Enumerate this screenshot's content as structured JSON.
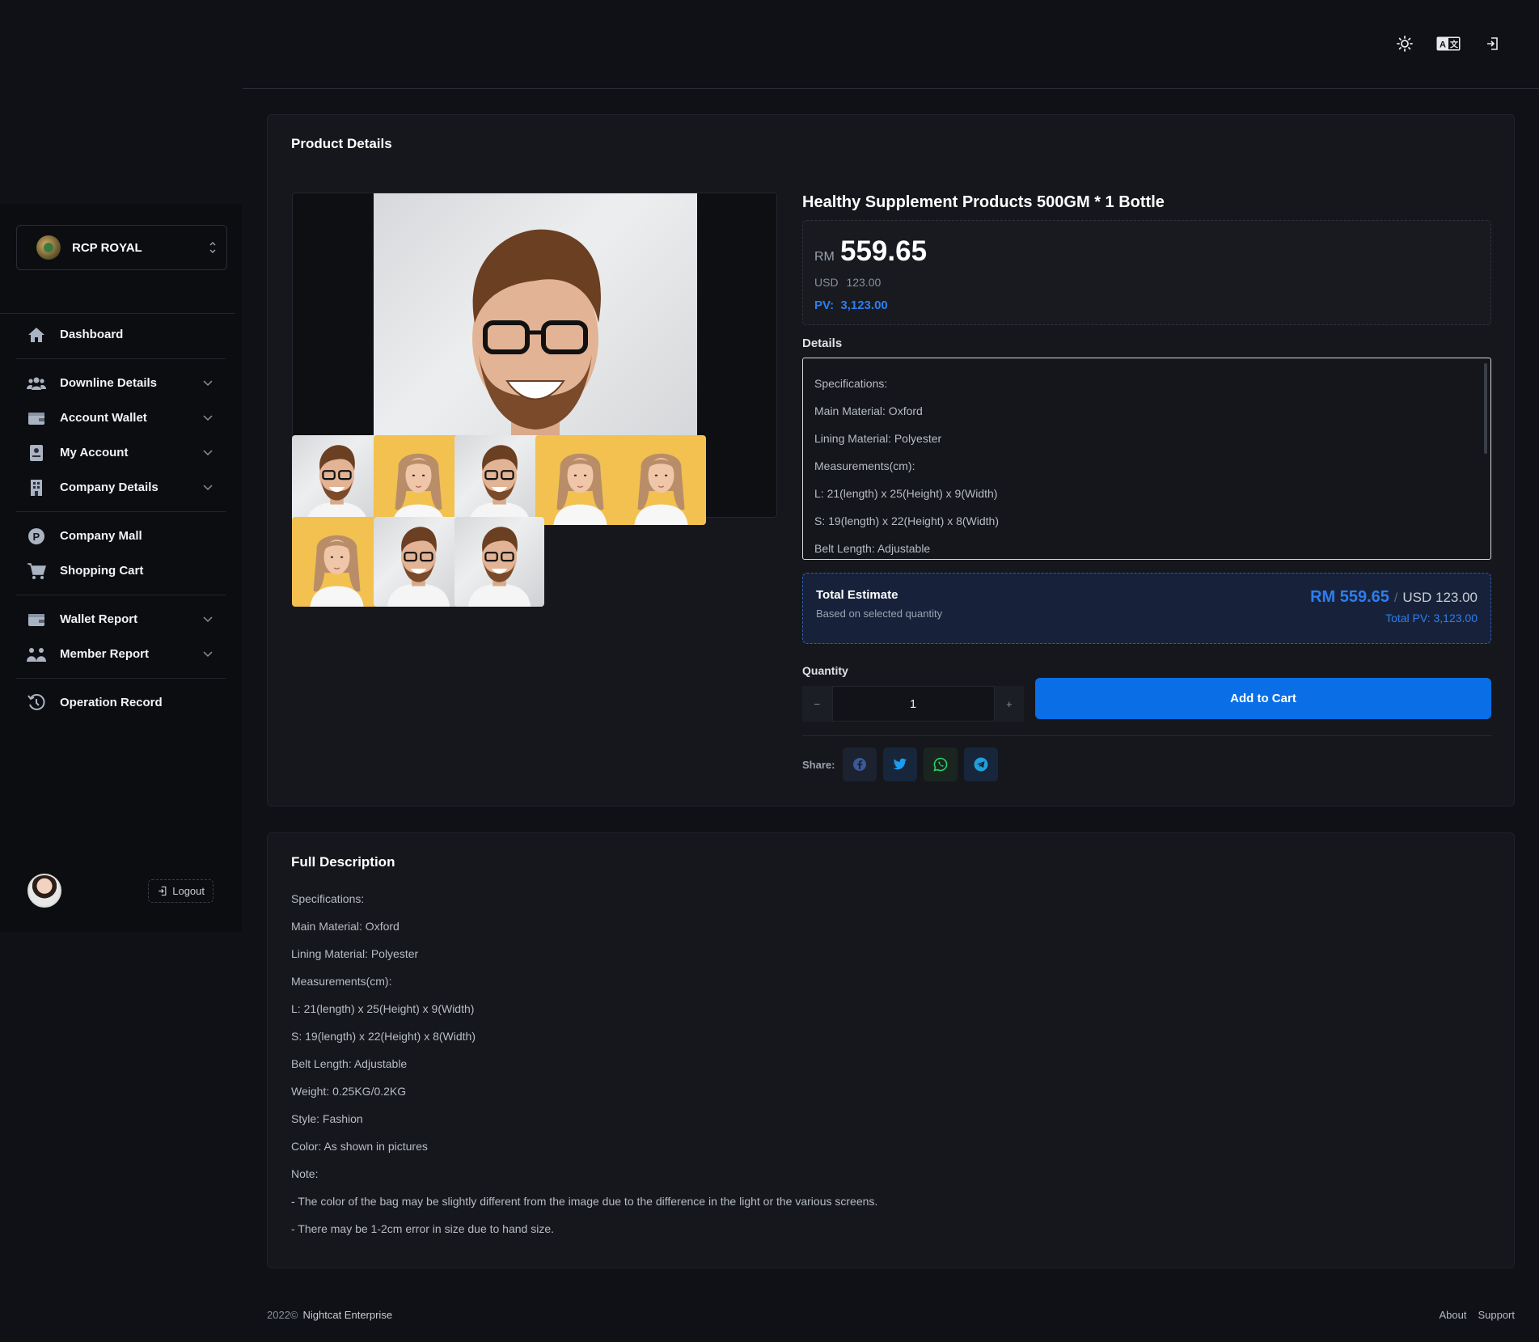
{
  "header": {
    "icons": [
      "sun-icon",
      "translate-icon",
      "login-icon"
    ]
  },
  "sidebar": {
    "brand": "RCP ROYAL",
    "groups": [
      [
        {
          "label": "Dashboard",
          "icon": "home-icon"
        }
      ],
      [
        {
          "label": "Downline Details",
          "icon": "users-icon"
        },
        {
          "label": "Account Wallet",
          "icon": "wallet-icon"
        },
        {
          "label": "My Account",
          "icon": "id-card-icon"
        },
        {
          "label": "Company Details",
          "icon": "building-icon"
        }
      ],
      [
        {
          "label": "Company Mall",
          "icon": "p-coin-icon"
        },
        {
          "label": "Shopping Cart",
          "icon": "cart-icon"
        }
      ],
      [
        {
          "label": "Wallet Report",
          "icon": "wallet-icon"
        },
        {
          "label": "Member Report",
          "icon": "people-icon"
        }
      ],
      [
        {
          "label": "Operation Record",
          "icon": "history-icon"
        }
      ]
    ],
    "logout_label": "Logout"
  },
  "product": {
    "card_title": "Product Details",
    "title": "Healthy Supplement Products 500GM * 1 Bottle",
    "price_currency": "RM",
    "price_value": "559.65",
    "usd_label": "USD",
    "usd_value": "123.00",
    "pv_label": "PV:",
    "pv_value": "3,123.00",
    "details_label": "Details",
    "details": [
      "Specifications:",
      "Main Material: Oxford",
      "Lining Material: Polyester",
      "Measurements(cm):",
      "L: 21(length) x 25(Height) x 9(Width)",
      "S: 19(length) x 22(Height) x 8(Width)",
      "Belt Length: Adjustable"
    ],
    "thumbnails": [
      "man",
      "woman",
      "man",
      "woman",
      "woman",
      "woman",
      "man",
      "man"
    ]
  },
  "estimate": {
    "title": "Total Estimate",
    "subtitle": "Based on selected quantity",
    "rm": "RM 559.65",
    "slash": "/",
    "usd": "USD 123.00",
    "pv": "Total PV: 3,123.00"
  },
  "quantity": {
    "label": "Quantity",
    "value": "1",
    "minus": "−",
    "plus": "+"
  },
  "cart": {
    "add_label": "Add to Cart"
  },
  "share": {
    "label": "Share:",
    "networks": [
      "facebook-icon",
      "twitter-icon",
      "whatsapp-icon",
      "telegram-icon"
    ]
  },
  "description": {
    "title": "Full Description",
    "lines": [
      "Specifications:",
      "Main Material: Oxford",
      "Lining Material: Polyester",
      "Measurements(cm):",
      "L: 21(length) x 25(Height) x 9(Width)",
      "S: 19(length) x 22(Height) x 8(Width)",
      "Belt Length: Adjustable",
      "Weight: 0.25KG/0.2KG",
      "Style: Fashion",
      "Color: As shown in pictures",
      "Note:",
      "- The color of the bag may be slightly different from the image due to the difference in the light or the various screens.",
      "- There may be 1-2cm error in size due to hand size."
    ]
  },
  "footer": {
    "year": "2022©",
    "company": "Nightcat Enterprise",
    "links": [
      "About",
      "Support"
    ]
  },
  "colors": {
    "accent": "#0a6fe6",
    "pv_blue": "#2e7df0",
    "background": "#0f1116",
    "card": "#15171c"
  }
}
